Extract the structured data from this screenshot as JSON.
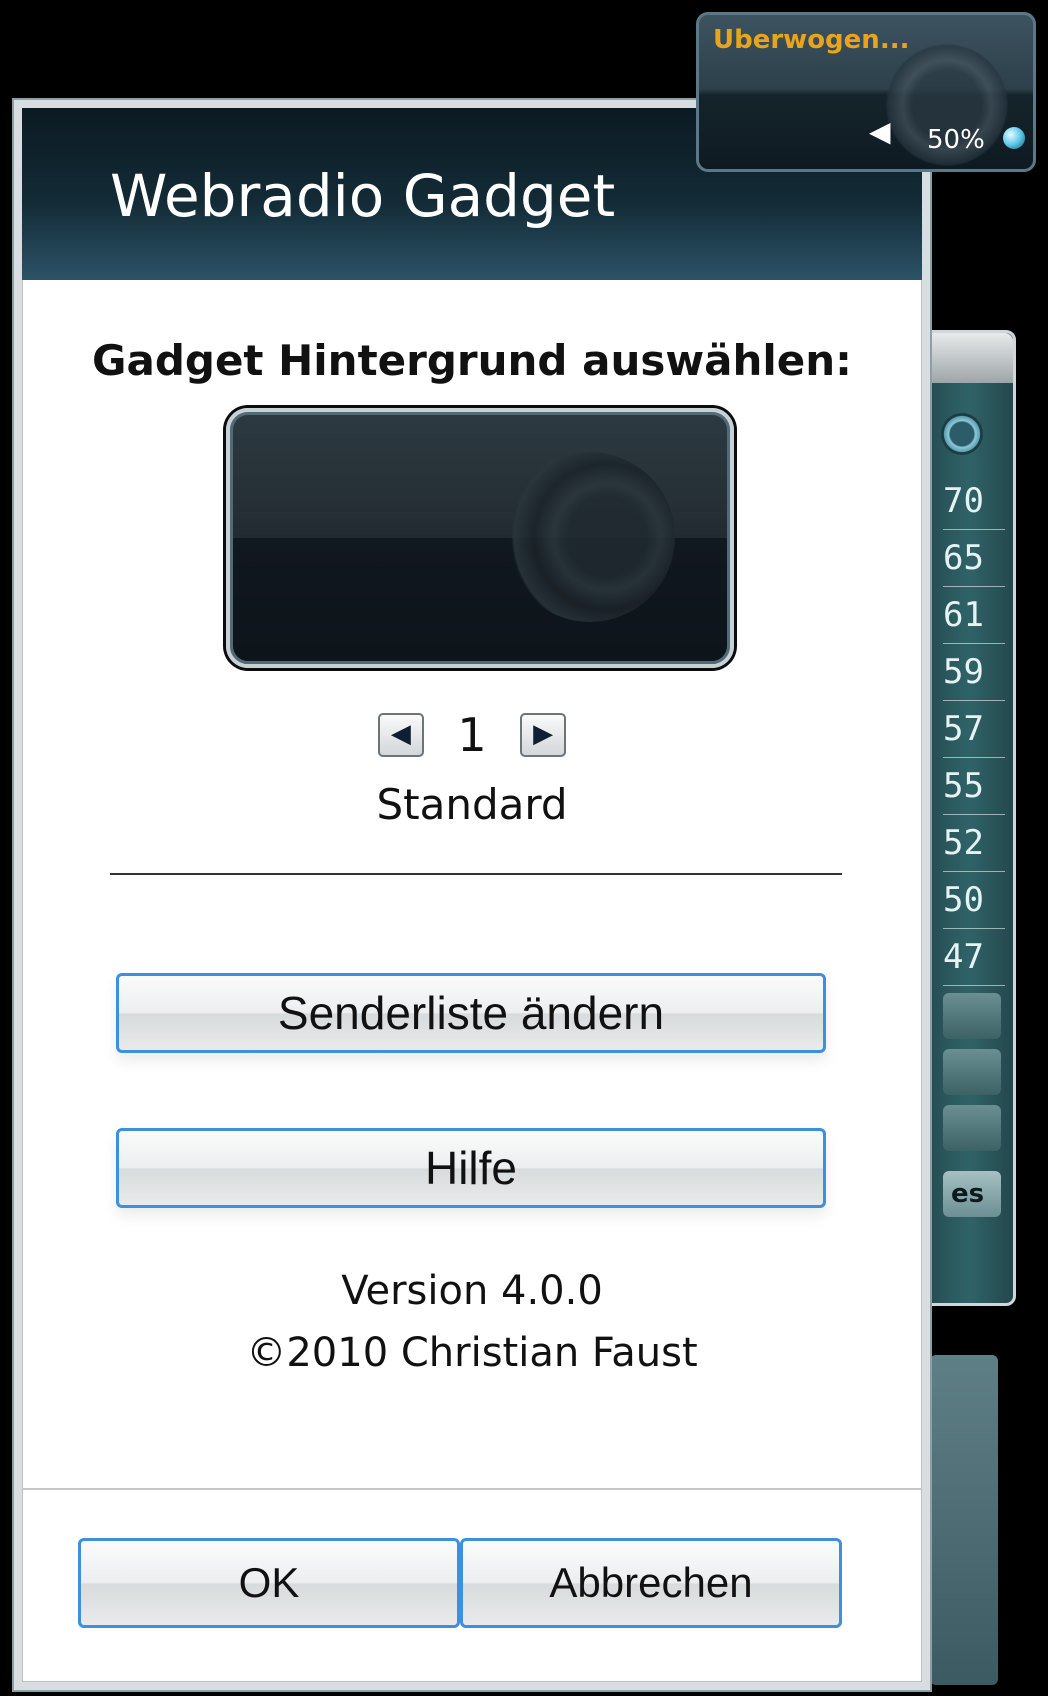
{
  "dialog": {
    "title": "Webradio Gadget",
    "background_heading": "Gadget Hintergrund auswählen:",
    "background_index": "1",
    "background_name": "Standard",
    "prev_label": "◀",
    "next_label": "▶",
    "edit_stations_label": "Senderliste ändern",
    "help_label": "Hilfe",
    "version": "Version 4.0.0",
    "copyright": "©2010 Christian Faust",
    "ok_label": "OK",
    "cancel_label": "Abbrechen"
  },
  "mini_gadget": {
    "station_text": "Uberwogen...",
    "volume_icon": "◀",
    "volume": "50%",
    "accent": "#e8a51c"
  },
  "side_gadget": {
    "values": [
      "70",
      "65",
      "61",
      "59",
      "57",
      "55",
      "52",
      "50",
      "47"
    ],
    "partial_button_label": "es"
  }
}
